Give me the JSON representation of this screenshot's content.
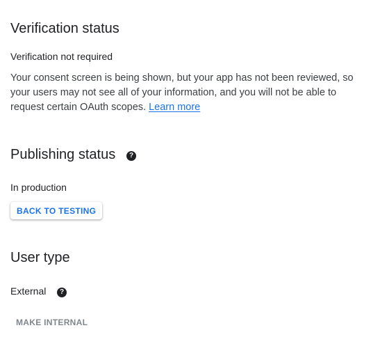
{
  "verification": {
    "title": "Verification status",
    "subtitle": "Verification not required",
    "description": "Your consent screen is being shown, but your app has not been reviewed, so your users may not see all of your information, and you will not be able to request certain OAuth scopes.",
    "link_label": "Learn more"
  },
  "publishing": {
    "title": "Publishing status",
    "help_icon": "help-circle-icon",
    "status": "In production",
    "button_label": "BACK TO TESTING"
  },
  "user_type": {
    "title": "User type",
    "value": "External",
    "help_icon": "help-circle-icon",
    "button_label": "MAKE INTERNAL"
  },
  "colors": {
    "accent": "#1a73e8",
    "text": "#202124",
    "muted": "#80868b"
  }
}
